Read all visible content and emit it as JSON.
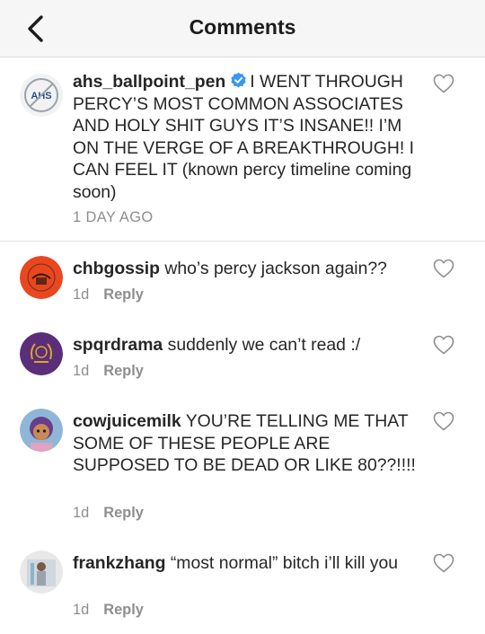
{
  "header": {
    "title": "Comments",
    "back_icon": "chevron-left-icon"
  },
  "caption": {
    "username": "ahs_ballpoint_pen",
    "verified": true,
    "text": "I WENT THROUGH PERCY’S MOST COMMON ASSOCIATES AND HOLY SHIT GUYS IT’S INSANE!! I’M ON THE VERGE OF A BREAKTHROUGH! I CAN FEEL IT (known percy timeline coming soon)",
    "age": "1 DAY AGO",
    "avatar_text": "AHS"
  },
  "comments": [
    {
      "username": "chbgossip",
      "text": "who’s percy jackson again??",
      "age": "1d",
      "reply_label": "Reply"
    },
    {
      "username": "spqrdrama",
      "text": "suddenly we can’t read :/",
      "age": "1d",
      "reply_label": "Reply"
    },
    {
      "username": "cowjuicemilk",
      "text": "YOU’RE TELLING ME THAT SOME OF THESE PEOPLE ARE SUPPOSED TO BE DEAD OR LIKE 80??!!!!",
      "age": "1d",
      "reply_label": "Reply"
    },
    {
      "username": "frankzhang",
      "text": "“most normal” bitch i’ll kill you",
      "age": "1d",
      "reply_label": "Reply"
    }
  ],
  "colors": {
    "header_bg": "#f6f6f7",
    "text": "#262626",
    "muted": "#8e8e8e",
    "verified_blue": "#3897f0",
    "chb_avatar": "#e8471f",
    "spqr_avatar": "#5b2e7a"
  },
  "icons": {
    "like": "heart-outline-icon",
    "verified": "verified-badge-icon"
  }
}
